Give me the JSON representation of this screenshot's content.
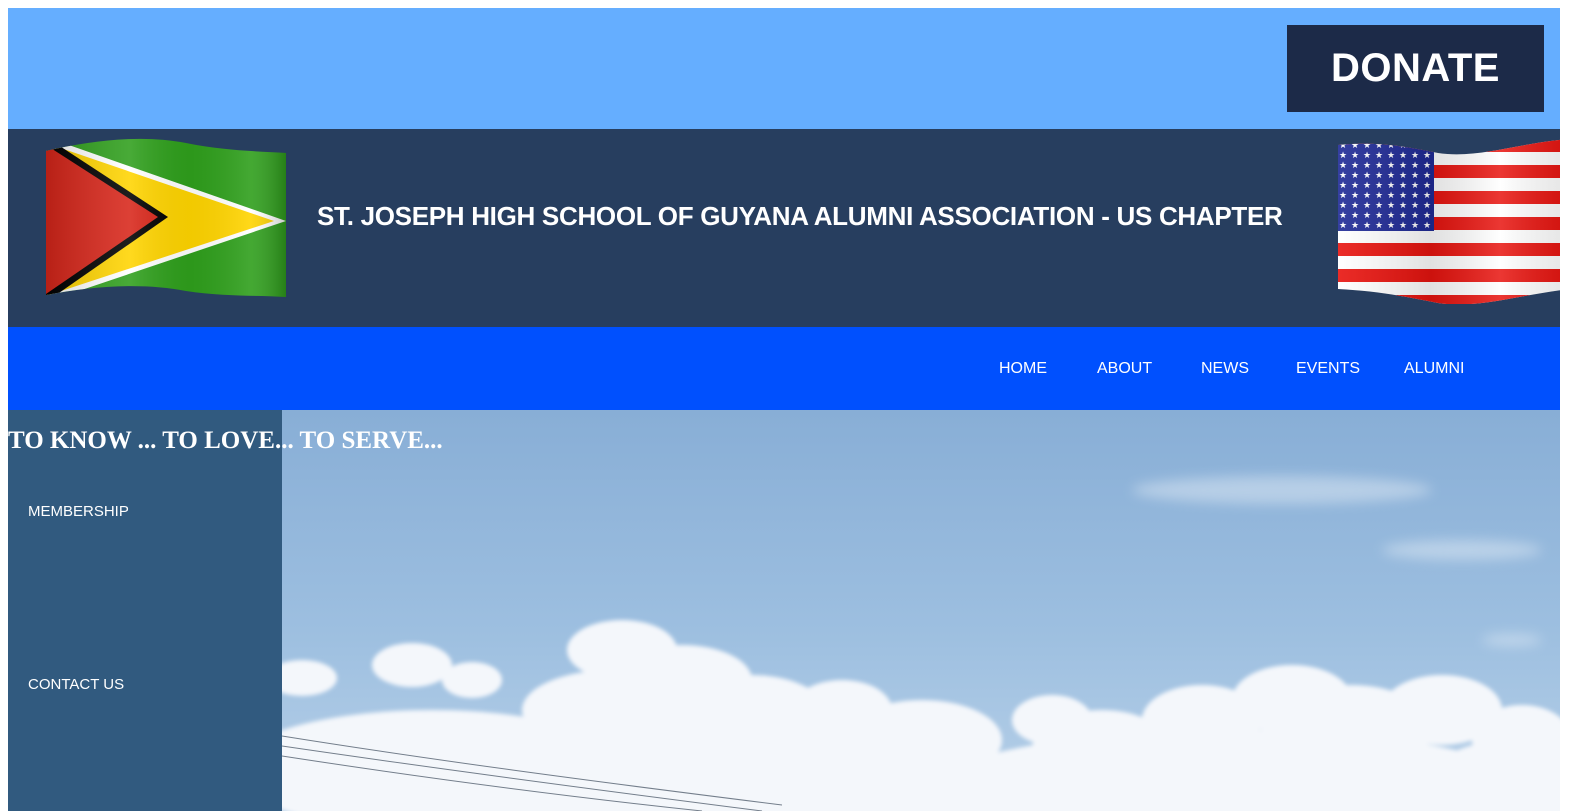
{
  "donate": {
    "label": "DONATE"
  },
  "header": {
    "title": "ST. JOSEPH HIGH SCHOOL OF GUYANA ALUMNI ASSOCIATION - US CHAPTER",
    "left_flag": "guyana-flag-icon",
    "right_flag": "usa-flag-icon"
  },
  "nav": {
    "items": [
      {
        "label": "HOME"
      },
      {
        "label": "ABOUT"
      },
      {
        "label": "NEWS"
      },
      {
        "label": "EVENTS"
      },
      {
        "label": "ALUMNI"
      }
    ]
  },
  "hero": {
    "motto": "TO KNOW ... TO LOVE... TO SERVE..."
  },
  "sidebar": {
    "items": [
      {
        "label": "MEMBERSHIP"
      },
      {
        "label": "CONTACT US"
      }
    ]
  },
  "colors": {
    "top_bar": "#65aeff",
    "donate_bg": "#1c2a48",
    "header_bg": "#273e5f",
    "nav_bg": "#0050fe",
    "sidebar_bg": "#315a7f"
  }
}
